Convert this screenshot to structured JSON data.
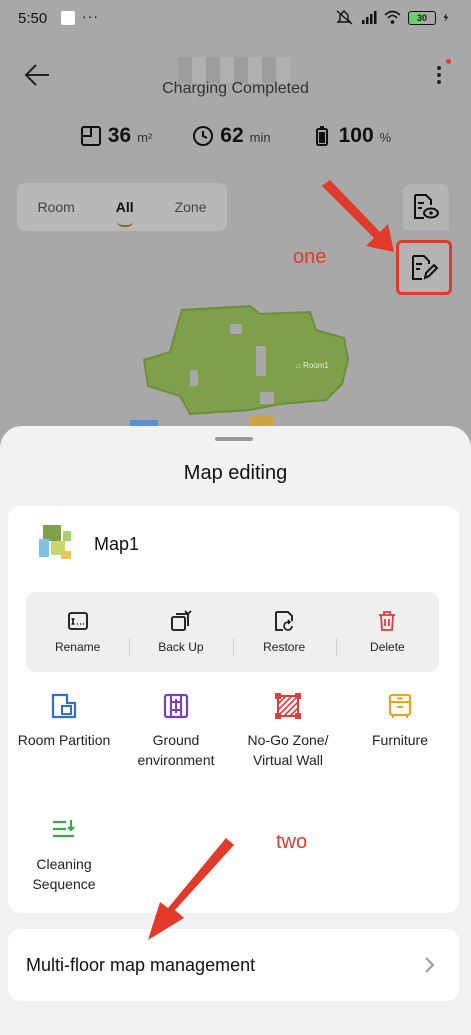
{
  "status_bar": {
    "time": "5:50",
    "dots": "···",
    "battery": "30"
  },
  "header": {
    "status": "Charging Completed"
  },
  "stats": [
    {
      "value": "36",
      "unit": "m²",
      "icon": "area-icon"
    },
    {
      "value": "62",
      "unit": "min",
      "icon": "clock-icon"
    },
    {
      "value": "100",
      "unit": "%",
      "icon": "battery-icon"
    }
  ],
  "mode_tabs": [
    "Room",
    "All",
    "Zone"
  ],
  "map": {
    "room_label": "⌂ Room1"
  },
  "annotations": {
    "one": "one",
    "two": "two"
  },
  "sheet": {
    "title": "Map editing",
    "map_name": "Map1",
    "actions": [
      {
        "label": "Rename",
        "icon": "rename-icon"
      },
      {
        "label": "Back Up",
        "icon": "backup-icon"
      },
      {
        "label": "Restore",
        "icon": "restore-icon"
      },
      {
        "label": "Delete",
        "icon": "delete-icon"
      }
    ],
    "features": [
      {
        "label": "Room Partition",
        "icon": "room-partition-icon"
      },
      {
        "label": "Ground environment",
        "icon": "ground-environment-icon"
      },
      {
        "label": "No-Go Zone/ Virtual Wall",
        "icon": "no-go-zone-icon"
      },
      {
        "label": "Furniture",
        "icon": "furniture-icon"
      },
      {
        "label": "Cleaning Sequence",
        "icon": "cleaning-sequence-icon"
      }
    ],
    "multi_floor": "Multi-floor map management"
  },
  "colors": {
    "accent_red": "#e13a2a",
    "map_green": "#7fa04a",
    "delete_red": "#e23b3b",
    "partition_blue": "#2f6fd8",
    "ground_purple": "#7a3fbf",
    "furniture_yellow": "#e8a620",
    "sequence_green": "#3aa84a"
  }
}
